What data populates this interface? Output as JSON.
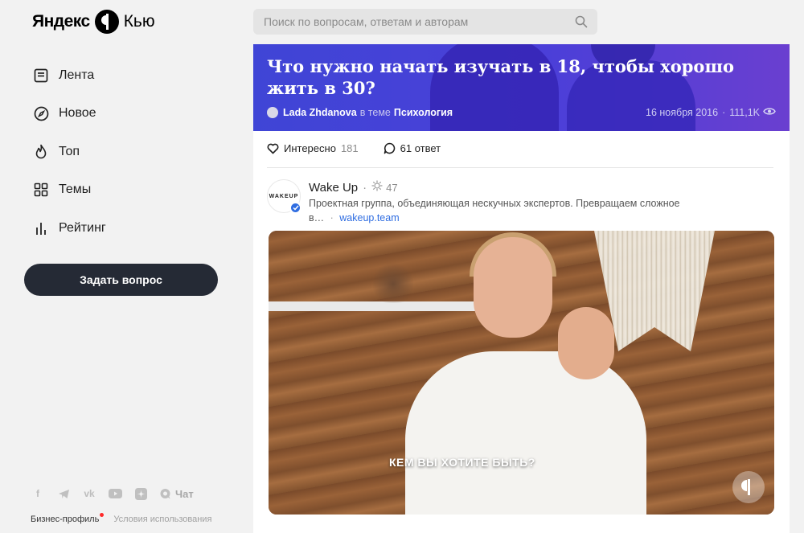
{
  "logo": {
    "yandex": "Яндекс",
    "q": "Кью"
  },
  "search": {
    "placeholder": "Поиск по вопросам, ответам и авторам"
  },
  "nav": {
    "items": [
      {
        "label": "Лента",
        "icon": "feed-icon"
      },
      {
        "label": "Новое",
        "icon": "compass-icon"
      },
      {
        "label": "Топ",
        "icon": "flame-icon"
      },
      {
        "label": "Темы",
        "icon": "grid-icon"
      },
      {
        "label": "Рейтинг",
        "icon": "rating-icon"
      }
    ]
  },
  "ask_button": "Задать вопрос",
  "footer": {
    "socials": [
      "facebook-icon",
      "telegram-icon",
      "vk-icon",
      "youtube-icon",
      "zen-icon",
      "chat-icon"
    ],
    "chat_label": "Чат",
    "business_profile": "Бизнес-профиль",
    "terms": "Условия использования"
  },
  "question": {
    "title": "Что нужно начать изучать в 18, чтобы хорошо жить в 30?",
    "author": "Lada Zhdanova",
    "in_topic": "в теме",
    "topic": "Психология",
    "date": "16 ноября 2016",
    "views": "111,1K",
    "interesting_label": "Интересно",
    "interesting_count": "181",
    "answers_label": "61 ответ"
  },
  "answer": {
    "avatar_text": "WAKEUP",
    "name": "Wake Up",
    "rating": "47",
    "description": "Проектная группа, объединяющая нескучных экспертов. Превращаем сложное",
    "description_cont": "в…",
    "link": "wakeup.team",
    "video_caption": "КЕМ ВЫ ХОТИТЕ БЫТЬ?"
  },
  "colors": {
    "hero_start": "#3f45d6",
    "hero_end": "#6a3fd0",
    "button_bg": "#252a35",
    "link": "#2f6de1"
  }
}
